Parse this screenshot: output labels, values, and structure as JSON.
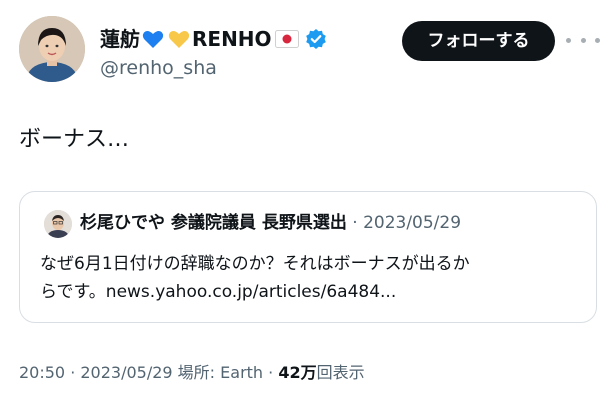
{
  "author": {
    "display_name_prefix": "蓮舫",
    "display_name_main": "RENHO",
    "handle": "@renho_sha",
    "badges": [
      "blue-heart-icon",
      "yellow-heart-icon",
      "japan-flag-icon",
      "verified-badge-icon"
    ]
  },
  "actions": {
    "follow_label": "フォローする",
    "more_icon": "more-icon"
  },
  "tweet": {
    "text": "ボーナス…"
  },
  "quote": {
    "author": "杉尾ひでや 参議院議員 長野県選出",
    "separator": "·",
    "date": "2023/05/29",
    "body_line1": "なぜ6月1日付けの辞職なのか？それはボーナスが出るか",
    "body_line2": "らです。news.yahoo.co.jp/articles/6a484..."
  },
  "meta": {
    "time": "20:50",
    "sep1": " · ",
    "date": "2023/05/29",
    "location_label": " 場所: Earth",
    "sep2": " · ",
    "views_count": "42万",
    "views_label": "回表示"
  },
  "colors": {
    "primary_text": "#0f1419",
    "secondary_text": "#536471",
    "button_bg": "#0f1419",
    "border": "#d8dee3",
    "verified_blue": "#1d9bf0",
    "blue_heart": "#1d7ff0",
    "yellow_heart": "#f7c84a",
    "flag_red": "#d7263d"
  }
}
